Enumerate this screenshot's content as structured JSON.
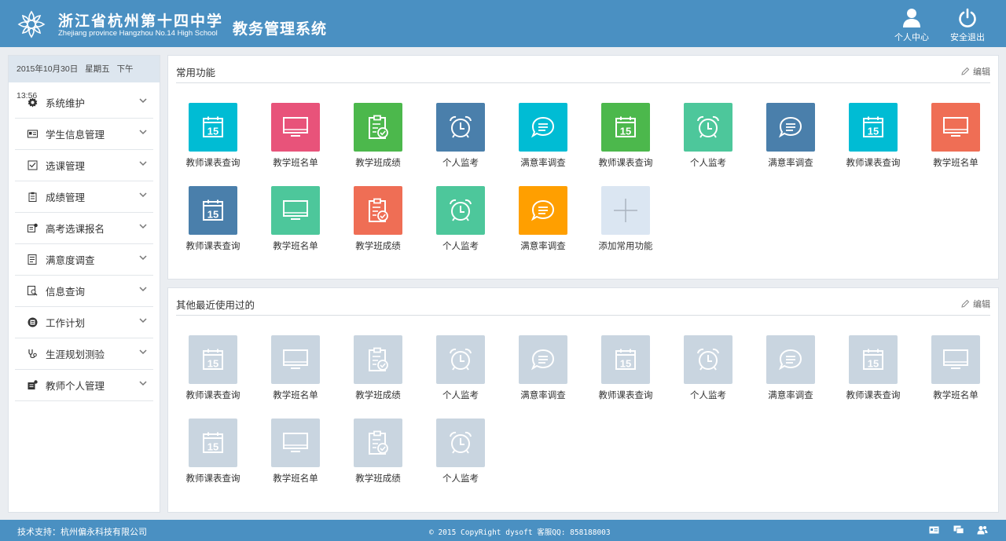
{
  "header": {
    "school_name_cn": "浙江省杭州第十四中学",
    "school_name_en": "Zhejiang province Hangzhou No.14 High School",
    "system_title": "教务管理系统",
    "profile_label": "个人中心",
    "logout_label": "安全退出"
  },
  "sidebar": {
    "date": "2015年10月30日",
    "weekday": "星期五",
    "time": "下午 13:56",
    "items": [
      {
        "label": "系统维护",
        "icon": "gear-icon"
      },
      {
        "label": "学生信息管理",
        "icon": "id-card-icon"
      },
      {
        "label": "选课管理",
        "icon": "checklist-icon"
      },
      {
        "label": "成绩管理",
        "icon": "clipboard-icon"
      },
      {
        "label": "高考选课报名",
        "icon": "register-icon"
      },
      {
        "label": "满意度调查",
        "icon": "survey-icon"
      },
      {
        "label": "信息查询",
        "icon": "search-doc-icon"
      },
      {
        "label": "工作计划",
        "icon": "plan-icon"
      },
      {
        "label": "生涯规划测验",
        "icon": "stethoscope-icon"
      },
      {
        "label": "教师个人管理",
        "icon": "teacher-icon"
      }
    ]
  },
  "common": {
    "title": "常用功能",
    "edit_label": "编辑",
    "tiles": [
      {
        "label": "教师课表查询",
        "icon": "calendar",
        "color": "#00bcd4"
      },
      {
        "label": "教学班名单",
        "icon": "monitor",
        "color": "#e8537a"
      },
      {
        "label": "教学班成绩",
        "icon": "clipboard",
        "color": "#4cb84c"
      },
      {
        "label": "个人监考",
        "icon": "alarm",
        "color": "#4a7fab"
      },
      {
        "label": "满意率调查",
        "icon": "chat",
        "color": "#00bcd4"
      },
      {
        "label": "教师课表查询",
        "icon": "calendar",
        "color": "#4cb84c"
      },
      {
        "label": "个人监考",
        "icon": "alarm",
        "color": "#4dc79b"
      },
      {
        "label": "满意率调查",
        "icon": "chat",
        "color": "#4a7fab"
      },
      {
        "label": "教师课表查询",
        "icon": "calendar",
        "color": "#00bcd4"
      },
      {
        "label": "教学班名单",
        "icon": "monitor",
        "color": "#ef6e55"
      },
      {
        "label": "教师课表查询",
        "icon": "calendar",
        "color": "#4a7fab"
      },
      {
        "label": "教学班名单",
        "icon": "monitor",
        "color": "#4dc79b"
      },
      {
        "label": "教学班成绩",
        "icon": "clipboard",
        "color": "#ef6e55"
      },
      {
        "label": "个人监考",
        "icon": "alarm",
        "color": "#4dc79b"
      },
      {
        "label": "满意率调查",
        "icon": "chat",
        "color": "#ff9f00"
      },
      {
        "label": "添加常用功能",
        "icon": "plus",
        "color": "#dbe6f2"
      }
    ]
  },
  "recent": {
    "title": "其他最近使用过的",
    "edit_label": "编辑",
    "tile_color": "#c9d5e0",
    "tiles": [
      {
        "label": "教师课表查询",
        "icon": "calendar"
      },
      {
        "label": "教学班名单",
        "icon": "monitor"
      },
      {
        "label": "教学班成绩",
        "icon": "clipboard"
      },
      {
        "label": "个人监考",
        "icon": "alarm"
      },
      {
        "label": "满意率调查",
        "icon": "chat"
      },
      {
        "label": "教师课表查询",
        "icon": "calendar"
      },
      {
        "label": "个人监考",
        "icon": "alarm"
      },
      {
        "label": "满意率调查",
        "icon": "chat"
      },
      {
        "label": "教师课表查询",
        "icon": "calendar"
      },
      {
        "label": "教学班名单",
        "icon": "monitor"
      },
      {
        "label": "教师课表查询",
        "icon": "calendar"
      },
      {
        "label": "教学班名单",
        "icon": "monitor"
      },
      {
        "label": "教学班成绩",
        "icon": "clipboard"
      },
      {
        "label": "个人监考",
        "icon": "alarm"
      }
    ]
  },
  "footer": {
    "support": "技术支持：杭州偏永科技有限公司",
    "copyright": "© 2015 CopyRight dysoft 客服QQ: 858188003"
  },
  "calendar_day": "15",
  "colors": {
    "header": "#4a90c2",
    "accent": "#4a90c2"
  }
}
